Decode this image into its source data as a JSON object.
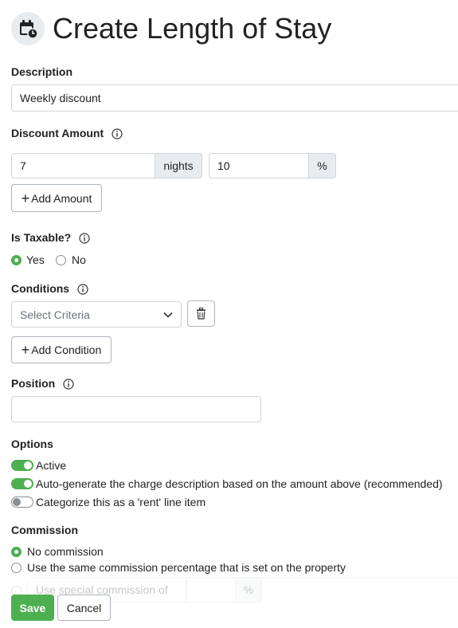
{
  "header": {
    "title": "Create Length of Stay",
    "icon": "calendar-clock-icon"
  },
  "description": {
    "label": "Description",
    "value": "Weekly discount"
  },
  "discount_amount": {
    "label": "Discount Amount",
    "nights_value": "7",
    "nights_unit": "nights",
    "percent_value": "10",
    "percent_unit": "%",
    "add_button": "Add Amount"
  },
  "taxable": {
    "label": "Is Taxable?",
    "options": [
      {
        "label": "Yes",
        "checked": true
      },
      {
        "label": "No",
        "checked": false
      }
    ]
  },
  "conditions": {
    "label": "Conditions",
    "select_placeholder": "Select Criteria",
    "add_button": "Add Condition"
  },
  "position": {
    "label": "Position",
    "value": ""
  },
  "options": {
    "label": "Options",
    "items": [
      {
        "label": "Active",
        "on": true
      },
      {
        "label": "Auto-generate the charge description based on the amount above (recommended)",
        "on": true
      },
      {
        "label": "Categorize this as a 'rent' line item",
        "on": false
      }
    ]
  },
  "commission": {
    "label": "Commission",
    "options": [
      {
        "label": "No commission",
        "checked": true
      },
      {
        "label": "Use the same commission percentage that is set on the property",
        "checked": false
      },
      {
        "label": "Use special commission of",
        "checked": false
      }
    ],
    "special_unit": "%"
  },
  "footer": {
    "save": "Save",
    "cancel": "Cancel"
  },
  "colors": {
    "accent": "#4caf50",
    "border": "#ced4da",
    "addon_bg": "#e9ecef"
  }
}
